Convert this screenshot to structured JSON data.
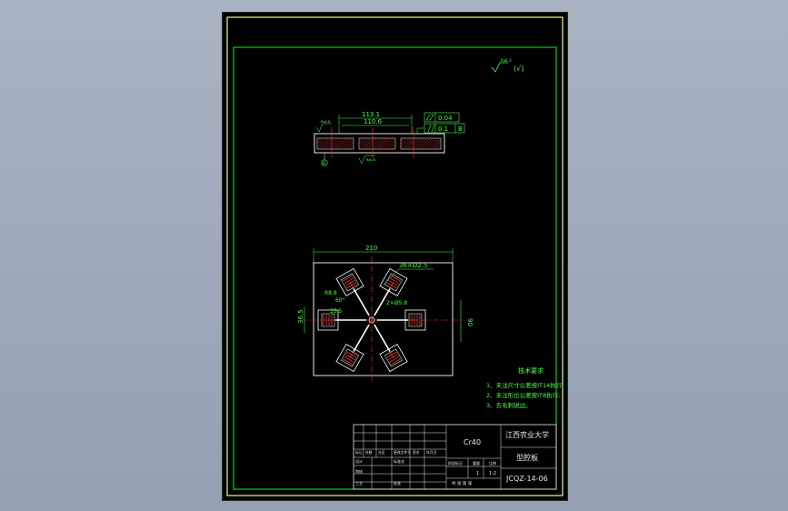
{
  "colors": {
    "frame": "#e6ff7a",
    "inner_frame": "#00ff00",
    "part": "#ffffff",
    "dimension": "#4cff4c",
    "center_line": "#ff3030",
    "hatch": "#ff3b3b",
    "table_text": "#e9e9e9"
  },
  "roughness_note": "(√)",
  "roughness_symbol": "Ra6.3",
  "side_view": {
    "dim_outer": "113.1",
    "dim_inner": "110.6",
    "tol_flatness": "0.04",
    "tol_parallel": "0.1",
    "tol_datum": "B",
    "datum_label": "B",
    "roughness_top": "Ra0.8",
    "roughness_bottom": "Ra0.8"
  },
  "plan_view": {
    "width_dim": "210",
    "height_dim": "90",
    "hole_note": "36×Ø2.5",
    "radius_dim": "R8.8",
    "angle_dim": "60°",
    "chamfer_dim": "2×Ø5.8",
    "offset_dim": "36.5",
    "pitch_dim": "35.5"
  },
  "tech_requirements": {
    "title": "技术要求",
    "items": [
      "1、未注尺寸公差按IT14执行;",
      "2、未注形位公差按IT8执行;",
      "3、去毛刺锐边。"
    ]
  },
  "title_block": {
    "material": "Cr40",
    "university": "江西农业大学",
    "part_name": "型腔板",
    "drawing_no": "JCQZ-14-06",
    "scale": "1:2",
    "sheet_count": "1",
    "weight_label": "重量",
    "scale_label": "比例",
    "stage_label": "阶段标记",
    "sheet_label": "共 张 第 张",
    "rev_headers": [
      "标记",
      "处数",
      "分区",
      "更改文件号",
      "签名",
      "年月日"
    ],
    "design_label": "设计",
    "std_label": "标准化",
    "check_label": "审核",
    "craft_label": "工艺",
    "approve_label": "批准"
  }
}
